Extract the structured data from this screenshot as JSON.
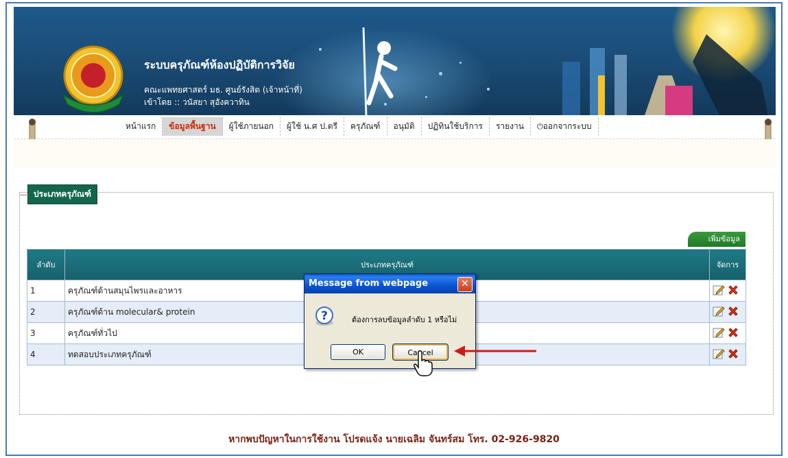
{
  "header": {
    "title": "ระบบครุภัณฑ์ห้องปฏิบัติการวิจัย",
    "subtitle": "คณะแพทยศาสตร์ มธ. ศูนย์รังสิต (เจ้าหน้าที่)",
    "user_line": "เข้าโดย :: วนัสยา สุอังควาทิน"
  },
  "menu": {
    "items": [
      {
        "label": "หน้าแรก",
        "active": false
      },
      {
        "label": "ข้อมูลพื้นฐาน",
        "active": true
      },
      {
        "label": "ผู้ใช้ภายนอก",
        "active": false
      },
      {
        "label": "ผู้ใช้ น.ศ ป.ตรี",
        "active": false
      },
      {
        "label": "ครุภัณฑ์",
        "active": false
      },
      {
        "label": "อนุมัติ",
        "active": false
      },
      {
        "label": "ปฏิทินใช้บริการ",
        "active": false
      },
      {
        "label": "รายงาน",
        "active": false
      },
      {
        "label": "ออกจากระบบ",
        "active": false
      }
    ]
  },
  "section": {
    "legend": "ประเภทครุภัณฑ์",
    "add_button": "เพิ่มข้อมูล"
  },
  "table": {
    "headers": [
      "ลำดับ",
      "ประเภทครุภัณฑ์",
      "จัดการ"
    ],
    "rows": [
      {
        "no": "1",
        "name": "ครุภัณฑ์ด้านสมุนไพรและอาหาร"
      },
      {
        "no": "2",
        "name": "ครุภัณฑ์ด้าน molecular& protein"
      },
      {
        "no": "3",
        "name": "ครุภัณฑ์ทั่วไป"
      },
      {
        "no": "4",
        "name": "ทดสอบประเภทครุภัณฑ์"
      }
    ]
  },
  "dialog": {
    "title": "Message from webpage",
    "message": "ต้องการลบข้อมูลลำดับ 1 หรือไม่",
    "ok_label": "OK",
    "cancel_label": "Cancel",
    "close_glyph": "✕"
  },
  "footer": {
    "text": "หากพบปัญหาในการใช้งาน โปรดแจ้ง นายเฉลิม จันทร์สม โทร. 02-926-9820"
  },
  "colors": {
    "banner": "#1b4d78",
    "menu_active_text": "#cc2a00",
    "legend_bg": "#13664c",
    "table_header": "#17606b",
    "footer_text": "#7a1f10",
    "annotation_arrow": "#cc1a1a"
  }
}
